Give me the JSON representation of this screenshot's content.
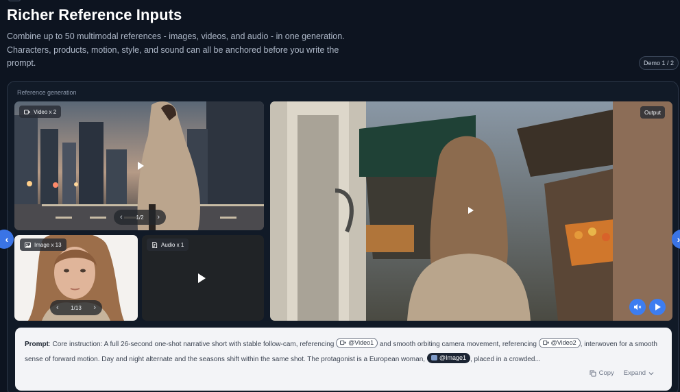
{
  "header": {
    "title": "Richer Reference Inputs",
    "subtitle": "Combine up to 50 multimodal references - images, videos, and audio - in one generation. Characters, products, motion, style, and sound can all be anchored before you write the prompt.",
    "demo_badge": "Demo 1 / 2"
  },
  "panel": {
    "label": "Reference generation",
    "video_ref": {
      "chip": "Video x 2",
      "pager": "1/2"
    },
    "image_ref": {
      "chip": "Image x 13",
      "pager": "1/13"
    },
    "audio_ref": {
      "chip": "Audio x 1"
    },
    "output": {
      "chip": "Output"
    }
  },
  "prompt": {
    "label": "Prompt",
    "segments": [
      {
        "type": "text",
        "value": ": Core instruction: A full 26-second one-shot narrative short with stable follow-cam, referencing "
      },
      {
        "type": "video",
        "value": "@Video1"
      },
      {
        "type": "text",
        "value": " and smooth orbiting camera movement, referencing "
      },
      {
        "type": "video",
        "value": "@Video2"
      },
      {
        "type": "text",
        "value": ", interwoven for a smooth sense of forward motion. Day and night alternate and the seasons shift within the same shot. The protagonist is a European woman, "
      },
      {
        "type": "image",
        "value": "@Image1"
      },
      {
        "type": "text",
        "value": ", placed in a crowded..."
      }
    ],
    "copy_label": "Copy",
    "expand_label": "Expand"
  },
  "colors": {
    "accent": "#3d7df0",
    "background": "#0d1420",
    "panel": "#111a27",
    "prompt_bg": "#f3f4f7"
  }
}
